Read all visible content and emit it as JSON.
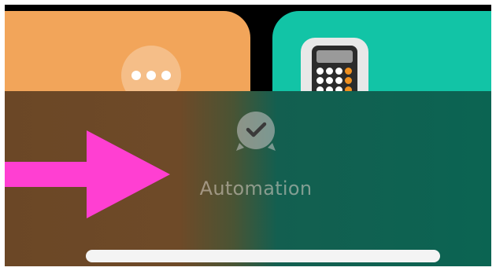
{
  "widget": {
    "label": "Automation",
    "icon": "clock-check-icon"
  },
  "tiles": [
    {
      "name": "orange-tile",
      "color": "#f2a55a",
      "icon": "more-icon"
    },
    {
      "name": "teal-tile",
      "color": "#12c4a6",
      "icon": "calculator-icon"
    }
  ],
  "annotation": {
    "icon": "arrow-right-icon",
    "color": "#ff3fd2"
  },
  "colors": {
    "overlay_left": "#6e4a28",
    "overlay_right": "#0b6452",
    "label": "#dcd2c8",
    "home_indicator": "#f4f4f4"
  }
}
